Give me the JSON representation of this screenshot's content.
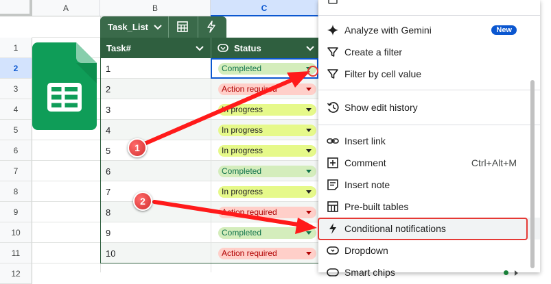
{
  "columns": [
    "A",
    "B",
    "C"
  ],
  "rows": [
    "1",
    "2",
    "3",
    "4",
    "5",
    "6",
    "7",
    "8",
    "9",
    "10",
    "11",
    "12"
  ],
  "table": {
    "name": "Task_List",
    "headers": {
      "task": "Task#",
      "status": "Status"
    },
    "rows": [
      {
        "num": "1",
        "status": "Completed"
      },
      {
        "num": "2",
        "status": "Action required"
      },
      {
        "num": "3",
        "status": "In progress"
      },
      {
        "num": "4",
        "status": "In progress"
      },
      {
        "num": "5",
        "status": "In progress"
      },
      {
        "num": "6",
        "status": "Completed"
      },
      {
        "num": "7",
        "status": "In progress"
      },
      {
        "num": "8",
        "status": "Action required"
      },
      {
        "num": "9",
        "status": "Completed"
      },
      {
        "num": "10",
        "status": "Action required"
      }
    ]
  },
  "status_colors": {
    "Completed": {
      "bg": "#d4edbc",
      "fg": "#11734b"
    },
    "Action required": {
      "bg": "#ffcfc9",
      "fg": "#b10202"
    },
    "In progress": {
      "bg": "#e6f98a",
      "fg": "#202124"
    }
  },
  "menu": {
    "items": {
      "gemini": "Analyze with Gemini",
      "gemini_badge": "New",
      "create_filter": "Create a filter",
      "filter_value": "Filter by cell value",
      "edit_history": "Show edit history",
      "insert_link": "Insert link",
      "comment": "Comment",
      "comment_shortcut": "Ctrl+Alt+M",
      "insert_note": "Insert note",
      "prebuilt_tables": "Pre-built tables",
      "conditional_notifications": "Conditional notifications",
      "dropdown": "Dropdown",
      "smart_chips": "Smart chips"
    }
  },
  "annotations": {
    "one": "1",
    "two": "2"
  },
  "colors": {
    "table_header": "#2f5f3f",
    "table_tab": "#3a6a4a",
    "highlight": "#e53935",
    "arrow": "#ff1a1a",
    "sheets_green": "#0f9d58"
  }
}
